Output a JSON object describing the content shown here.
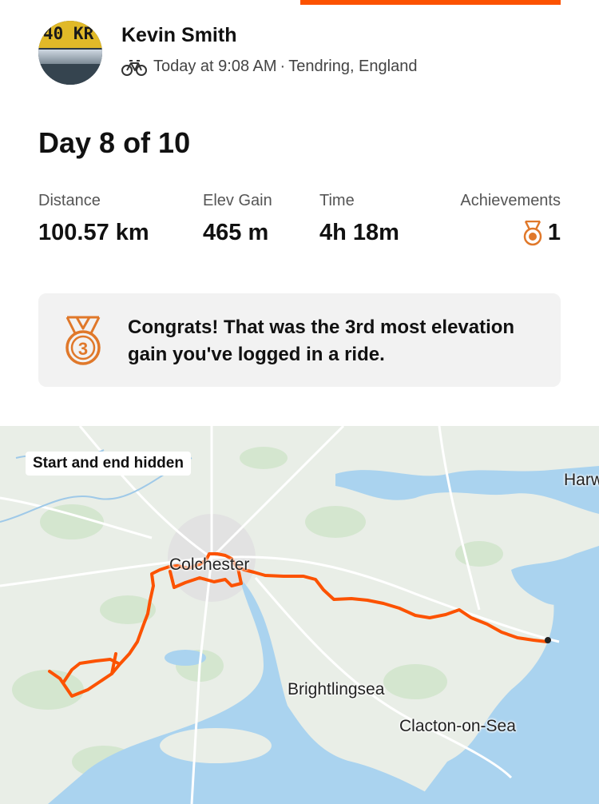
{
  "athlete": {
    "name": "Kevin Smith",
    "avatar_plate_text": "40 KR",
    "activity_type_icon": "bike-icon",
    "timestamp": "Today at 9:08 AM",
    "separator": "·",
    "location": "Tendring, England"
  },
  "activity": {
    "title": "Day 8 of 10"
  },
  "stats": {
    "distance": {
      "label": "Distance",
      "value": "100.57 km"
    },
    "elev_gain": {
      "label": "Elev Gain",
      "value": "465 m"
    },
    "time": {
      "label": "Time",
      "value": "4h 18m"
    },
    "achievements": {
      "label": "Achievements",
      "value": "1",
      "icon": "bronze-medal-icon"
    }
  },
  "congrats": {
    "icon": "bronze-medal-3-icon",
    "message": "Congrats! That was the 3rd most elevation gain you've logged in a ride."
  },
  "map": {
    "badge": "Start and end hidden",
    "places": {
      "colchester": "Colchester",
      "brightlingsea": "Brightlingsea",
      "clacton": "Clacton-on-Sea",
      "harwich": "Harw"
    },
    "colors": {
      "route": "#fc5200",
      "sea": "#aad3ef",
      "land": "#e9eee7",
      "accent": "#fc5200",
      "medal": "#e0782a"
    }
  }
}
